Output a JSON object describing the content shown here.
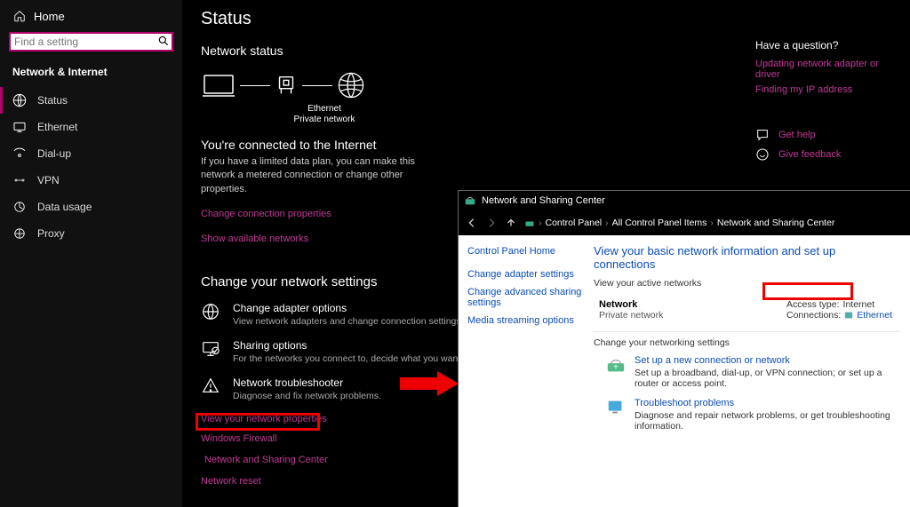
{
  "sidebar": {
    "home": "Home",
    "search_placeholder": "Find a setting",
    "heading": "Network & Internet",
    "items": [
      {
        "label": "Status"
      },
      {
        "label": "Ethernet"
      },
      {
        "label": "Dial-up"
      },
      {
        "label": "VPN"
      },
      {
        "label": "Data usage"
      },
      {
        "label": "Proxy"
      }
    ]
  },
  "page_title": "Status",
  "network_status": {
    "heading": "Network status",
    "diagram_label1": "Ethernet",
    "diagram_label2": "Private network"
  },
  "connected": {
    "title": "You're connected to the Internet",
    "body": "If you have a limited data plan, you can make this network a metered connection or change other properties.",
    "change_props": "Change connection properties",
    "show_networks": "Show available networks"
  },
  "change_settings": {
    "heading": "Change your network settings",
    "adapter_title": "Change adapter options",
    "adapter_desc": "View network adapters and change connection settings.",
    "sharing_title": "Sharing options",
    "sharing_desc": "For the networks you connect to, decide what you want to share.",
    "trouble_title": "Network troubleshooter",
    "trouble_desc": "Diagnose and fix network problems.",
    "view_props": "View your network properties",
    "firewall": "Windows Firewall",
    "sharing_center": "Network and Sharing Center",
    "reset": "Network reset"
  },
  "help": {
    "title": "Have a question?",
    "link1": "Updating network adapter or driver",
    "link2": "Finding my IP address",
    "get_help": "Get help",
    "feedback": "Give feedback"
  },
  "cp": {
    "window_title": "Network and Sharing Center",
    "crumbs": [
      "Control Panel",
      "All Control Panel Items",
      "Network and Sharing Center"
    ],
    "side_links": [
      "Control Panel Home",
      "Change adapter settings",
      "Change advanced sharing settings",
      "Media streaming options"
    ],
    "main_heading": "View your basic network information and set up connections",
    "sub_heading": "View your active networks",
    "net_name": "Network",
    "net_type": "Private network",
    "access_label": "Access type:",
    "access_value": "Internet",
    "conn_label": "Connections:",
    "conn_value": "Ethernet",
    "change_heading": "Change your networking settings",
    "task1_title": "Set up a new connection or network",
    "task1_desc": "Set up a broadband, dial-up, or VPN connection; or set up a router or access point.",
    "task2_title": "Troubleshoot problems",
    "task2_desc": "Diagnose and repair network problems, or get troubleshooting information."
  }
}
